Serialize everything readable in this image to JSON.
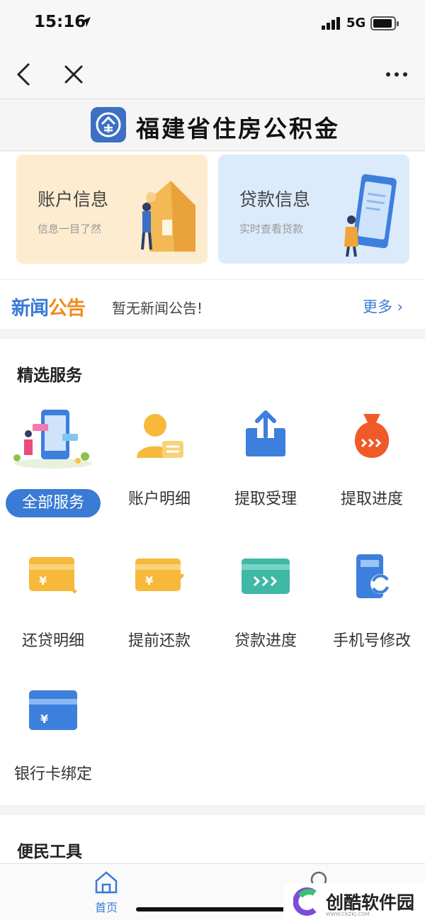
{
  "status_bar": {
    "time": "15:16",
    "network": "5G"
  },
  "nav": {
    "back": "back",
    "close": "close",
    "more": "more"
  },
  "brand": {
    "title": "福建省住房公积金",
    "logo_char": "金"
  },
  "cards": [
    {
      "title": "账户信息",
      "subtitle": "信息一目了然"
    },
    {
      "title": "贷款信息",
      "subtitle": "实时查看贷款"
    }
  ],
  "news": {
    "label_part1": "新闻",
    "label_part2": "公告",
    "text": "暂无新闻公告!",
    "more": "更多 ›"
  },
  "services": {
    "title": "精选服务",
    "items": [
      {
        "label": "全部服务",
        "icon": "all-services-icon"
      },
      {
        "label": "账户明细",
        "icon": "account-detail-icon"
      },
      {
        "label": "提取受理",
        "icon": "withdraw-apply-icon"
      },
      {
        "label": "提取进度",
        "icon": "withdraw-progress-icon"
      },
      {
        "label": "还贷明细",
        "icon": "repay-detail-icon"
      },
      {
        "label": "提前还款",
        "icon": "prepay-icon"
      },
      {
        "label": "贷款进度",
        "icon": "loan-progress-icon"
      },
      {
        "label": "手机号修改",
        "icon": "phone-edit-icon"
      },
      {
        "label": "银行卡绑定",
        "icon": "bank-card-icon"
      }
    ]
  },
  "tools": {
    "title": "便民工具"
  },
  "tabbar": {
    "home": "首页"
  },
  "watermark": {
    "text": "创酷软件园",
    "url": "WWW.CKZKJ.COM"
  },
  "colors": {
    "accent": "#3a7bd5",
    "orange": "#f08b1d",
    "card_orange_bg": "#fdecd0",
    "card_blue_bg": "#dcebfb"
  }
}
